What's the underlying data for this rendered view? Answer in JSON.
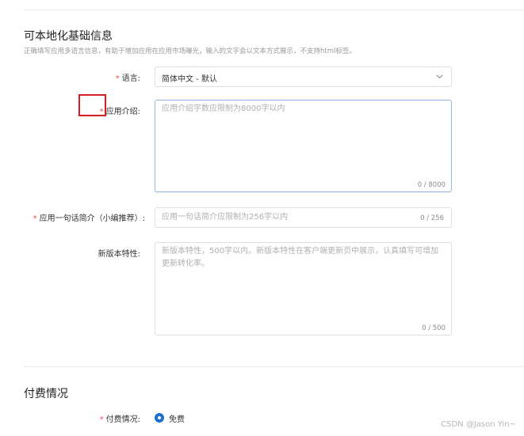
{
  "section_localized": {
    "title": "可本地化基础信息",
    "subtitle": "正确填写应用多语言信息，有助于增加应用在应用市场曝光，输入的文字会以文本方式展示，不支持html标签。"
  },
  "fields": {
    "language": {
      "required_mark": "*",
      "label": "语言:",
      "value": "简体中文 - 默认"
    },
    "intro": {
      "required_mark": "*",
      "label": "应用介绍:",
      "placeholder": "应用介绍字数应限制为8000字以内",
      "counter": "0 / 8000"
    },
    "one_line": {
      "required_mark": "*",
      "label": "应用一句话简介（小编推荐）:",
      "placeholder": "应用一句话简介应限制为256字以内",
      "counter": "0 / 256"
    },
    "new_features": {
      "label": "新版本特性:",
      "placeholder": "新版本特性，500字以内。新版本特性在客户端更新页中展示，认真填写可增加更新转化率。",
      "counter": "0 / 500"
    }
  },
  "section_payment": {
    "title": "付费情况",
    "field": {
      "required_mark": "*",
      "label": "付费情况:",
      "option_free": "免费"
    }
  },
  "watermark": "CSDN @Jason Yin~",
  "colors": {
    "required": "#e84c3d",
    "accent": "#1f6fd1",
    "annotation": "#d81e1e"
  }
}
